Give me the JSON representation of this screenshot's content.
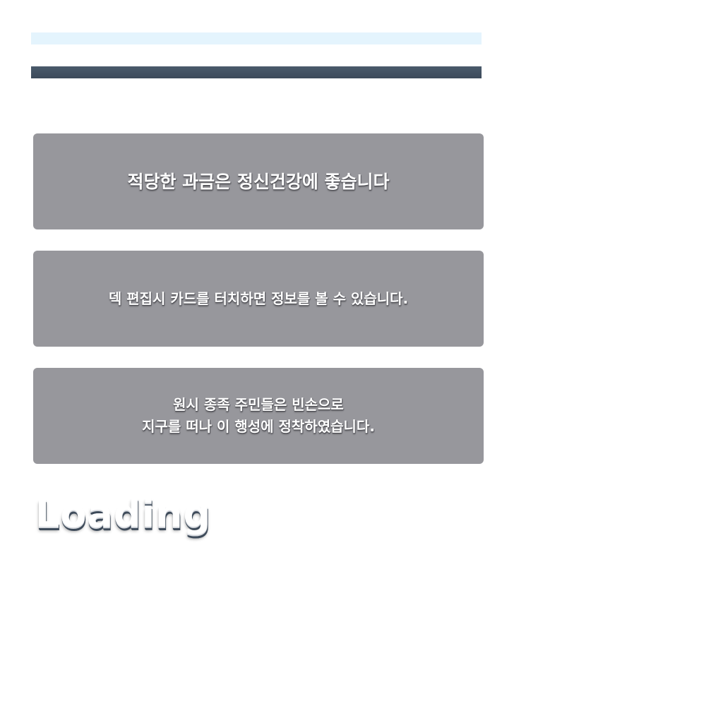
{
  "tips": [
    {
      "text": "적당한 과금은 정신건강에 좋습니다"
    },
    {
      "text": "덱 편집시 카드를 터치하면 정보를 볼 수 있습니다."
    },
    {
      "text": "원시 종족 주민들은 빈손으로\n지구를 떠나 이 행성에 정착하였습니다."
    }
  ],
  "loading": {
    "label": "Loading"
  },
  "colors": {
    "background": "#ffffff",
    "top_bar": "#e4f4fd",
    "dark_bar": "#3c4a5a",
    "tip_card": "#97979c",
    "text": "#ffffff"
  }
}
